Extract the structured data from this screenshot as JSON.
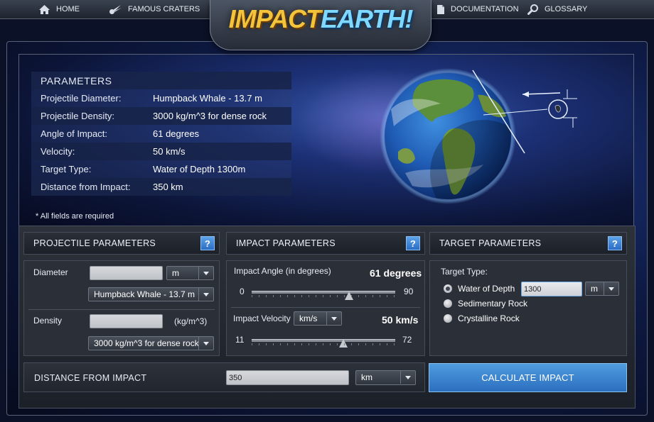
{
  "nav": {
    "home": "HOME",
    "famous_craters": "FAMOUS CRATERS",
    "documentation": "DOCUMENTATION",
    "glossary": "GLOSSARY"
  },
  "logo": {
    "part1": "IMPACT",
    "part2": "EARTH!"
  },
  "summary": {
    "title": "PARAMETERS",
    "rows": [
      {
        "label": "Projectile Diameter:",
        "value": "Humpback Whale - 13.7 m"
      },
      {
        "label": "Projectile Density:",
        "value": "3000 kg/m^3 for dense rock"
      },
      {
        "label": "Angle of Impact:",
        "value": "61 degrees"
      },
      {
        "label": "Velocity:",
        "value": "50 km/s"
      },
      {
        "label": "Target Type:",
        "value": "Water of Depth 1300m"
      },
      {
        "label": "Distance from Impact:",
        "value": "350 km"
      }
    ],
    "required_note": "* All fields are required"
  },
  "projectile": {
    "title": "PROJECTILE PARAMETERS",
    "help": "?",
    "diameter_label": "Diameter",
    "diameter_value": "",
    "diameter_unit": "m",
    "diameter_preset": "Humpback Whale - 13.7 m",
    "density_label": "Density",
    "density_value": "",
    "density_unit": "(kg/m^3)",
    "density_preset": "3000 kg/m^3 for dense rock"
  },
  "impact": {
    "title": "IMPACT PARAMETERS",
    "help": "?",
    "angle_label": "Impact Angle (in degrees)",
    "angle_display": "61 degrees",
    "angle_min": "0",
    "angle_max": "90",
    "angle_value": 61,
    "velocity_label": "Impact Velocity",
    "velocity_unit": "km/s",
    "velocity_display": "50 km/s",
    "velocity_min": "11",
    "velocity_max": "72",
    "velocity_value": 50
  },
  "target": {
    "title": "TARGET PARAMETERS",
    "help": "?",
    "type_label": "Target Type:",
    "options": [
      "Water of Depth",
      "Sedimentary Rock",
      "Crystalline Rock"
    ],
    "selected_index": 0,
    "depth_value": "1300",
    "depth_unit": "m"
  },
  "distance": {
    "label": "DISTANCE FROM IMPACT",
    "value": "350",
    "unit": "km"
  },
  "calculate_label": "CALCULATE IMPACT",
  "colors": {
    "accent_blue": "#2c6fbf",
    "logo_gold": "#f2c33b",
    "logo_blue": "#7fd8ff"
  },
  "icons": {
    "home": "home-icon",
    "craters": "comet-icon",
    "documentation": "document-icon",
    "glossary": "magnifier-icon"
  }
}
